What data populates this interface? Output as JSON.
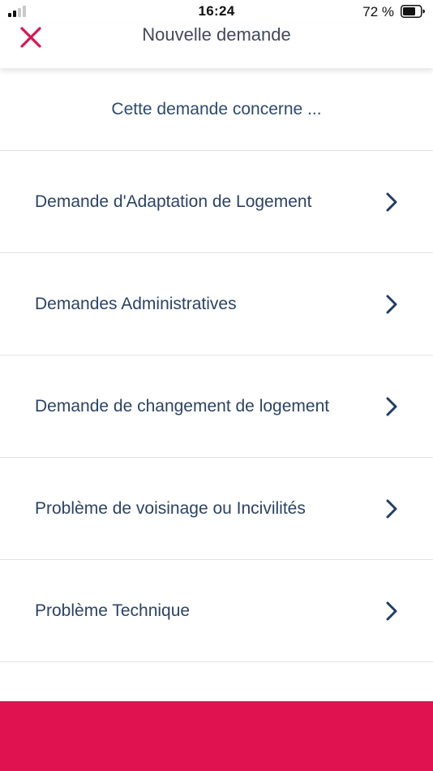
{
  "status_bar": {
    "time": "16:24",
    "battery_percent": "72 %",
    "battery_level": 0.72,
    "signal_bars_active": 2,
    "signal_bars_total": 4
  },
  "header": {
    "title": "Nouvelle demande",
    "close_icon": "close-x-icon",
    "accent_color": "#e0124f"
  },
  "prompt": "Cette demande concerne ...",
  "options": [
    {
      "label": "Demande d'Adaptation de Logement",
      "icon": "chevron-right-icon"
    },
    {
      "label": "Demandes Administratives",
      "icon": "chevron-right-icon"
    },
    {
      "label": "Demande de changement de logement",
      "icon": "chevron-right-icon"
    },
    {
      "label": "Problème de voisinage ou Incivilités",
      "icon": "chevron-right-icon"
    },
    {
      "label": "Problème Technique",
      "icon": "chevron-right-icon"
    }
  ],
  "colors": {
    "text_primary": "#2b4366",
    "chevron": "#1f3d66",
    "divider": "#e2e2e2",
    "bottom_band": "#e0124f"
  }
}
